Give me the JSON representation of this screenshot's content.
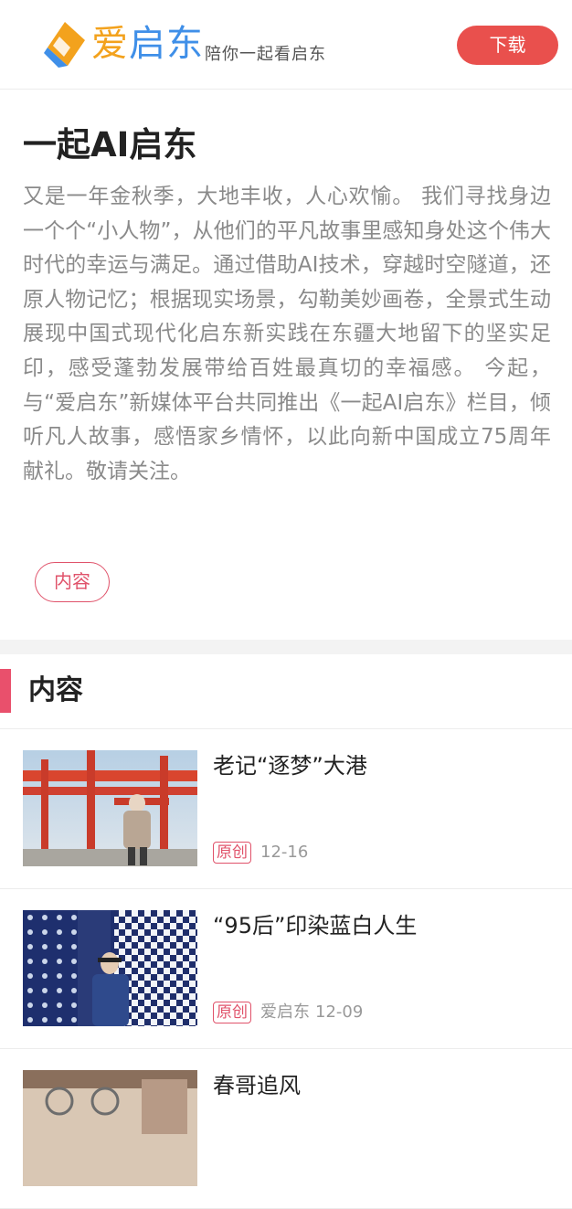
{
  "header": {
    "brand_first": "爱",
    "brand_rest": "启东",
    "slogan": "陪你一起看启东",
    "download_label": "下载"
  },
  "intro": {
    "title": "一起AI启东",
    "description": "又是一年金秋季，大地丰收，人心欢愉。 我们寻找身边一个个“小人物”，从他们的平凡故事里感知身处这个伟大时代的幸运与满足。通过借助AI技术，穿越时空隧道，还原人物记忆；根据现实场景，勾勒美妙画卷，全景式生动展现中国式现代化启东新实践在东疆大地留下的坚实足印，感受蓬勃发展带给百姓最真切的幸福感。 今起，与“爱启东”新媒体平台共同推出《一起AI启东》栏目，倾听凡人故事，感悟家乡情怀，以此向新中国成立75周年献礼。敬请关注。",
    "tag_label": "内容"
  },
  "section": {
    "title": "内容"
  },
  "articles": [
    {
      "title": "老记“逐梦”大港",
      "badge": "原创",
      "source": "",
      "date": "12-16"
    },
    {
      "title": "“95后”印染蓝白人生",
      "badge": "原创",
      "source": "爱启东",
      "date": "12-09"
    },
    {
      "title": "春哥追风",
      "badge": "",
      "source": "",
      "date": ""
    }
  ],
  "colors": {
    "accent": "#e9504d",
    "tag": "#e0526a",
    "brand_blue": "#3f8fe8",
    "brand_orange": "#f3a21d"
  }
}
